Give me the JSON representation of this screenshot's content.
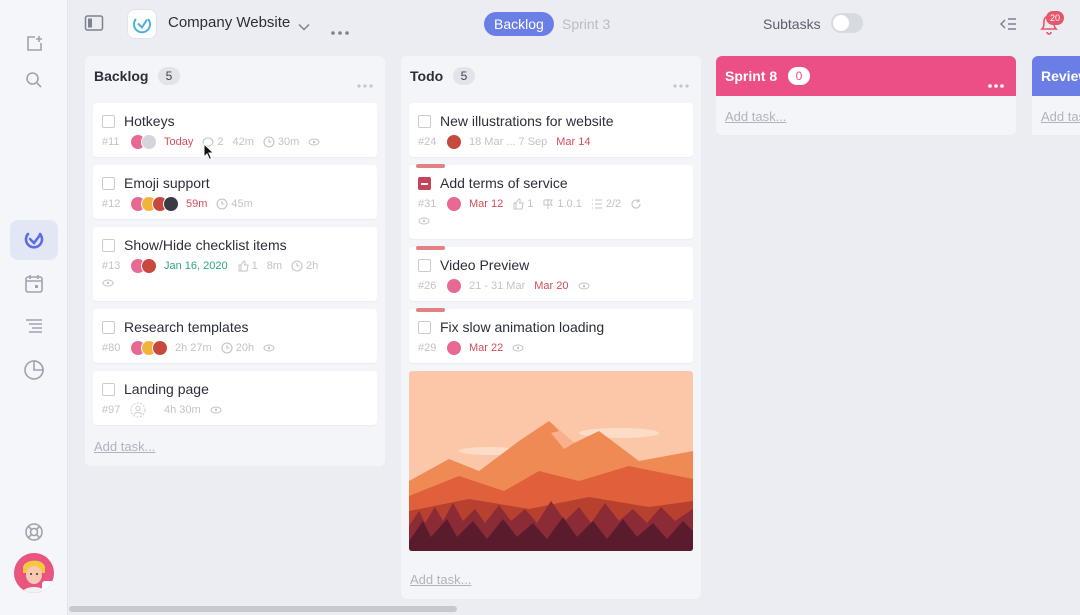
{
  "header": {
    "project_name": "Company Website",
    "sprint_active": "Backlog",
    "sprint_other": "Sprint 3",
    "subtasks_label": "Subtasks",
    "notification_count": "20"
  },
  "colors": {
    "accent": "#6a7ee6",
    "sprint8": "#ec4f86",
    "review": "#6a7ee6",
    "overdue": "#d64d5b",
    "future": "#2ea87b"
  },
  "columns": {
    "backlog": {
      "title": "Backlog",
      "count": "5",
      "add_task": "Add task...",
      "cards": [
        {
          "title": "Hotkeys",
          "id": "#11",
          "due": "Today",
          "comments": "2",
          "time_spent": "42m",
          "estimate": "30m"
        },
        {
          "title": "Emoji support",
          "id": "#12",
          "time_spent": "59m",
          "estimate": "45m"
        },
        {
          "title": "Show/Hide checklist items",
          "id": "#13",
          "due": "Jan 16, 2020",
          "likes": "1",
          "time_spent": "8m",
          "estimate": "2h"
        },
        {
          "title": "Research templates",
          "id": "#80",
          "time_spent": "2h 27m",
          "estimate": "20h"
        },
        {
          "title": "Landing page",
          "id": "#97",
          "time_spent": "4h 30m"
        }
      ]
    },
    "todo": {
      "title": "Todo",
      "count": "5",
      "add_task": "Add task...",
      "cards": [
        {
          "title": "New illustrations for website",
          "id": "#24",
          "dates": "18 Mar ... 7 Sep",
          "due": "Mar 14"
        },
        {
          "title": "Add terms of service",
          "id": "#31",
          "due": "Mar 12",
          "likes": "1",
          "version": "1.0.1",
          "checklist": "2/2"
        },
        {
          "title": "Video Preview",
          "id": "#26",
          "dates": "21 - 31 Mar",
          "due": "Mar 20"
        },
        {
          "title": "Fix slow animation loading",
          "id": "#29",
          "due": "Mar 22"
        }
      ]
    },
    "sprint8": {
      "title": "Sprint 8",
      "count": "0",
      "add_task": "Add task..."
    },
    "review": {
      "title": "Review",
      "add_task": "Add task..."
    }
  }
}
